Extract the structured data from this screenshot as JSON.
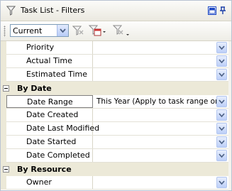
{
  "window": {
    "title": "Task List - Filters"
  },
  "toolbar": {
    "filter_combo_value": "Current"
  },
  "grid": {
    "rows": [
      {
        "type": "property",
        "name": "Priority",
        "value": ""
      },
      {
        "type": "property",
        "name": "Actual Time",
        "value": ""
      },
      {
        "type": "property",
        "name": "Estimated Time",
        "value": ""
      },
      {
        "type": "category",
        "name": "By Date"
      },
      {
        "type": "property",
        "name": "Date Range",
        "value": "This Year (Apply to task range only)",
        "selected": true
      },
      {
        "type": "property",
        "name": "Date Created",
        "value": ""
      },
      {
        "type": "property",
        "name": "Date Last Modified",
        "value": ""
      },
      {
        "type": "property",
        "name": "Date Started",
        "value": ""
      },
      {
        "type": "property",
        "name": "Date Completed",
        "value": ""
      },
      {
        "type": "category",
        "name": "By Resource"
      },
      {
        "type": "property",
        "name": "Owner",
        "value": ""
      }
    ]
  }
}
